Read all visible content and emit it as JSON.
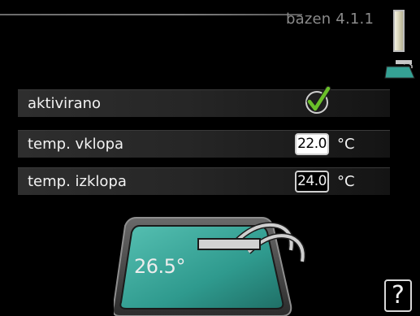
{
  "header": {
    "title": "bazen 4.1.1"
  },
  "rows": [
    {
      "label": "aktivirano",
      "control": "checkbox",
      "checked": true,
      "icon": "checkmark-icon"
    },
    {
      "label": "temp. vklopa",
      "value": "22.0",
      "unit": "°C",
      "selected": true
    },
    {
      "label": "temp. izklopa",
      "value": "24.0",
      "unit": "°C",
      "selected": false
    }
  ],
  "pool": {
    "temperature": "26.5°",
    "icon": "pool-icon"
  },
  "help": {
    "label": "?",
    "icon": "help-icon"
  },
  "colors": {
    "background": "#000000",
    "pool_water": "#3aa59a",
    "check_green": "#6abf2a",
    "title_grey": "#8a8a8a"
  }
}
